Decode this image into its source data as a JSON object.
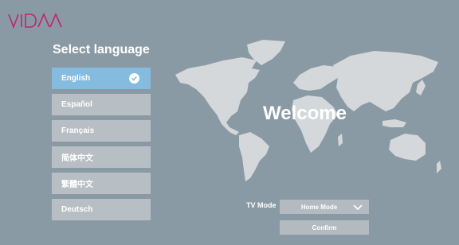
{
  "brand": {
    "name": "VIDAA",
    "color": "#c0246f"
  },
  "title": "Select language",
  "languages": [
    {
      "label": "English",
      "selected": true
    },
    {
      "label": "Español",
      "selected": false
    },
    {
      "label": "Français",
      "selected": false
    },
    {
      "label": "简体中文",
      "selected": false
    },
    {
      "label": "繁體中文",
      "selected": false
    },
    {
      "label": "Deutsch",
      "selected": false
    }
  ],
  "welcome": "Welcome",
  "tv_mode": {
    "label": "TV Mode",
    "value": "Home Mode"
  },
  "confirm_label": "Confirm",
  "colors": {
    "background": "#8a9aa5",
    "selected": "#86bbe0",
    "item": "#b8bfc4",
    "map": "#d4d8db"
  }
}
